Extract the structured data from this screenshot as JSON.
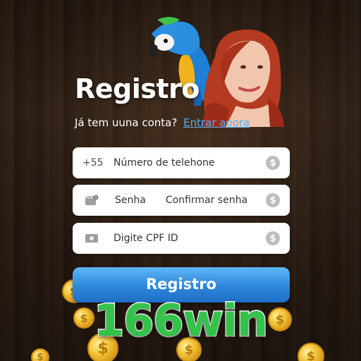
{
  "header": {
    "title": "Registro",
    "subtitle": "Já tem uuna conta?",
    "login_link": "Entrar aoora"
  },
  "form": {
    "phone": {
      "prefix": "+55",
      "placeholder": "Número de telehone"
    },
    "password": {
      "label": "Senha",
      "confirm_label": "Confirmar senha"
    },
    "cpf": {
      "placeholder": "Digite CPF ID"
    },
    "currency_symbol": "$"
  },
  "submit": {
    "label": "Registro"
  },
  "brand": {
    "name": "166win"
  },
  "colors": {
    "brand_green": "#34c34a",
    "button_blue": "#2d86db",
    "link_blue": "#4fb2ff"
  }
}
